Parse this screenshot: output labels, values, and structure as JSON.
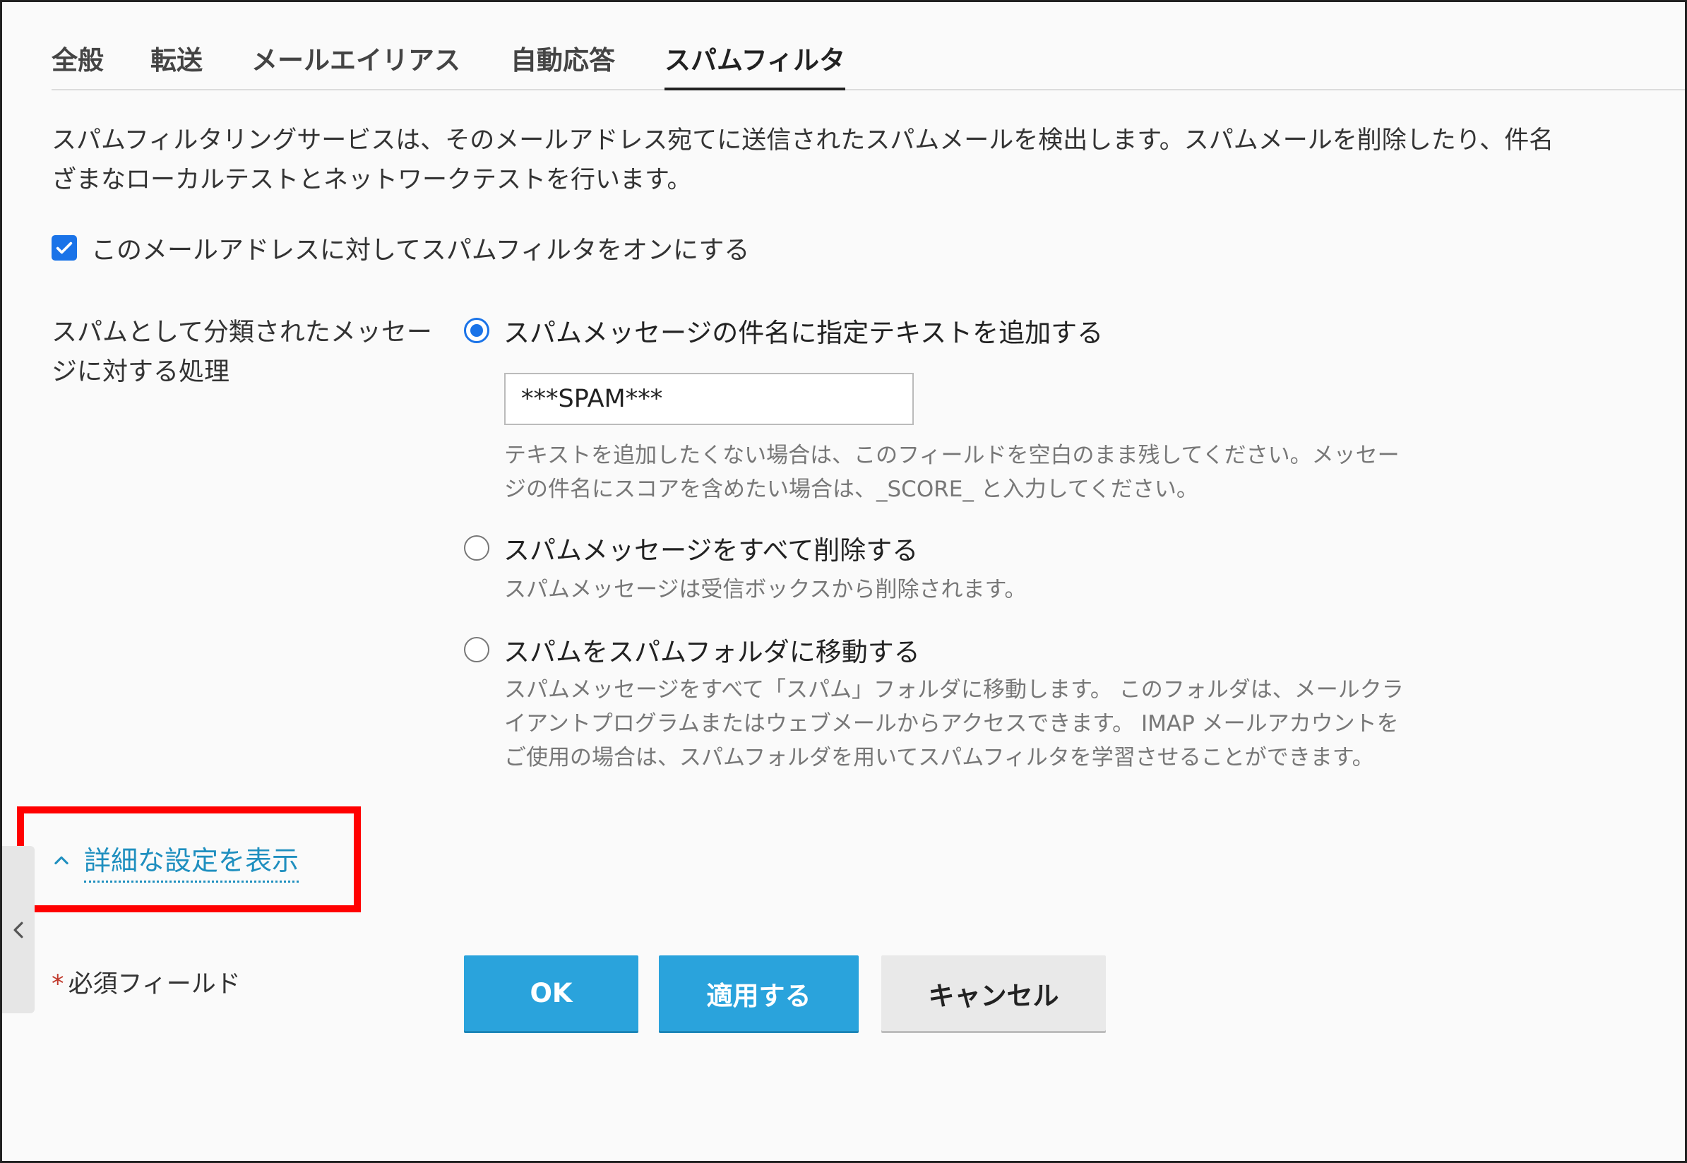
{
  "tabs": [
    {
      "label": "全般",
      "active": false
    },
    {
      "label": "転送",
      "active": false
    },
    {
      "label": "メールエイリアス",
      "active": false
    },
    {
      "label": "自動応答",
      "active": false
    },
    {
      "label": "スパムフィルタ",
      "active": true
    }
  ],
  "description": {
    "line1": "スパムフィルタリングサービスは、そのメールアドレス宛てに送信されたスパムメールを検出します。スパムメールを削除したり、件名",
    "line2": "ざまなローカルテストとネットワークテストを行います。"
  },
  "enable_filter": {
    "label": "このメールアドレスに対してスパムフィルタをオンにする",
    "checked": true
  },
  "action": {
    "label": "スパムとして分類されたメッセージに対する処理",
    "options": [
      {
        "label": "スパムメッセージの件名に指定テキストを追加する",
        "checked": true,
        "input_value": "***SPAM***",
        "help_line1": "テキストを追加したくない場合は、このフィールドを空白のまま残してください。メッセー",
        "help_line2": "ジの件名にスコアを含めたい場合は、_SCORE_ と入力してください。"
      },
      {
        "label": "スパムメッセージをすべて削除する",
        "checked": false,
        "help_line1": "スパムメッセージは受信ボックスから削除されます。"
      },
      {
        "label": "スパムをスパムフォルダに移動する",
        "checked": false,
        "help_line1": "スパムメッセージをすべて「スパム」フォルダに移動します。 このフォルダは、メールクラ",
        "help_line2": "イアントプログラムまたはウェブメールからアクセスできます。 IMAP メールアカウントを",
        "help_line3": "ご使用の場合は、スパムフォルダを用いてスパムフィルタを学習させることができます。"
      }
    ]
  },
  "advanced_toggle": {
    "label": "詳細な設定を表示",
    "icon": "chevron-up-icon"
  },
  "required_note": {
    "star": "*",
    "text": "必須フィールド"
  },
  "buttons": {
    "ok": "OK",
    "apply": "適用する",
    "cancel": "キャンセル"
  },
  "colors": {
    "primary": "#2aa3dc",
    "link": "#1f8fbf",
    "highlight": "#ff0000",
    "checkbox": "#1a73e8"
  }
}
